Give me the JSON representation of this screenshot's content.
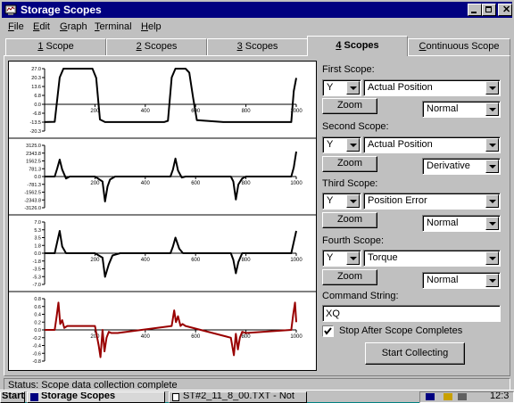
{
  "window": {
    "title": "Storage Scopes"
  },
  "menu": [
    {
      "label": "File",
      "mnemonic": "F",
      "rest": "ile"
    },
    {
      "label": "Edit",
      "mnemonic": "E",
      "rest": "dit"
    },
    {
      "label": "Graph",
      "mnemonic": "G",
      "rest": "raph"
    },
    {
      "label": "Terminal",
      "mnemonic": "T",
      "rest": "erminal"
    },
    {
      "label": "Help",
      "mnemonic": "H",
      "rest": "elp"
    }
  ],
  "tabs": [
    {
      "label": "1 Scope",
      "mnemonic": "1",
      "rest": " Scope"
    },
    {
      "label": "2 Scopes",
      "mnemonic": "2",
      "rest": " Scopes"
    },
    {
      "label": "3 Scopes",
      "mnemonic": "3",
      "rest": " Scopes"
    },
    {
      "label": "4 Scopes",
      "mnemonic": "4",
      "rest": " Scopes",
      "active": true
    },
    {
      "label": "Continuous Scope",
      "mnemonic": "C",
      "rest": "ontinuous Scope"
    }
  ],
  "scopes": [
    {
      "heading": "First Scope:",
      "axis": "Y",
      "source": "Actual Position",
      "zoom_label": "Zoom",
      "mode": "Normal"
    },
    {
      "heading": "Second Scope:",
      "axis": "Y",
      "source": "Actual Position",
      "zoom_label": "Zoom",
      "mode": "Derivative"
    },
    {
      "heading": "Third Scope:",
      "axis": "Y",
      "source": "Position Error",
      "zoom_label": "Zoom",
      "mode": "Normal"
    },
    {
      "heading": "Fourth Scope:",
      "axis": "Y",
      "source": "Torque",
      "zoom_label": "Zoom",
      "mode": "Normal"
    }
  ],
  "command": {
    "label": "Command String:",
    "value": "XQ"
  },
  "stop_after": {
    "label": "Stop After Scope Completes",
    "checked": true
  },
  "start_button": "Start Collecting",
  "status_text": "Status: Scope data collection complete",
  "taskbar": {
    "start_label": "Start",
    "items": [
      "Storage Scopes",
      "ST#2_11_8_00.TXT - Not"
    ],
    "clock": "12:3"
  },
  "colors": {
    "trace_black": "#000000",
    "trace_red": "#990000",
    "titlebar": "#000080",
    "face": "#c0c0c0",
    "desktop": "#008080"
  },
  "chart_data": [
    {
      "type": "line",
      "yticks": [
        "27.0",
        "20.3",
        "13.6",
        "6.8",
        "0.0",
        "-6.8",
        "-13.5",
        "-20.3"
      ],
      "xticks": [
        "200",
        "400",
        "600",
        "800",
        "1000"
      ],
      "xlim": [
        0,
        1000
      ],
      "ylim": [
        -20.3,
        27.0
      ],
      "color": "#000000",
      "x": [
        0,
        40,
        60,
        75,
        190,
        205,
        220,
        240,
        475,
        490,
        505,
        520,
        560,
        575,
        590,
        605,
        710,
        725,
        740,
        755,
        980,
        990,
        1000
      ],
      "y": [
        -13.5,
        -13.3,
        20.3,
        27.0,
        27.0,
        20.0,
        -11.5,
        -13.5,
        -13.5,
        -12.5,
        20.3,
        27.0,
        27.0,
        24.0,
        5.0,
        -12.0,
        -13.5,
        -13.5,
        -13.5,
        -13.5,
        -13.5,
        10.0,
        20.0
      ]
    },
    {
      "type": "line",
      "yticks": [
        "3125.0",
        "2343.8",
        "1562.5",
        "781.3",
        "0.0",
        "-781.3",
        "-1562.5",
        "-2343.8",
        "-3126.0"
      ],
      "xticks": [
        "200",
        "400",
        "600",
        "800",
        "1000"
      ],
      "xlim": [
        0,
        1000
      ],
      "ylim": [
        -3126.0,
        3125.0
      ],
      "color": "#000000",
      "x": [
        0,
        40,
        50,
        60,
        70,
        85,
        100,
        200,
        230,
        240,
        250,
        260,
        280,
        300,
        500,
        510,
        520,
        530,
        545,
        560,
        740,
        750,
        760,
        770,
        785,
        800,
        980,
        990,
        1000
      ],
      "y": [
        0,
        0,
        800,
        1700,
        700,
        -200,
        0,
        0,
        -500,
        -2500,
        -1000,
        -300,
        0,
        0,
        0,
        700,
        1800,
        600,
        -100,
        0,
        0,
        -500,
        -2300,
        -800,
        -200,
        0,
        0,
        900,
        2500
      ]
    },
    {
      "type": "line",
      "yticks": [
        "7.0",
        "5.3",
        "3.5",
        "1.8",
        "0.0",
        "-1.8",
        "-3.5",
        "-5.3",
        "-7.0"
      ],
      "xticks": [
        "200",
        "400",
        "600",
        "800",
        "1000"
      ],
      "xlim": [
        0,
        1000
      ],
      "ylim": [
        -7.0,
        7.0
      ],
      "color": "#000000",
      "x": [
        0,
        40,
        50,
        60,
        70,
        85,
        200,
        230,
        240,
        255,
        270,
        300,
        500,
        510,
        520,
        535,
        550,
        740,
        750,
        760,
        770,
        785,
        980,
        990,
        1000
      ],
      "y": [
        0,
        0,
        2.5,
        5.0,
        1.5,
        0,
        0,
        -1.0,
        -5.3,
        -2.5,
        -0.5,
        0,
        0,
        1.5,
        3.5,
        1.0,
        0,
        0,
        -1.5,
        -4.5,
        -2.0,
        0,
        0,
        2.5,
        5.0
      ]
    },
    {
      "type": "line",
      "yticks": [
        "0.8",
        "0.6",
        "0.4",
        "0.2",
        "0.0",
        "-0.2",
        "-0.4",
        "-0.6",
        "-0.8"
      ],
      "xticks": [
        "200",
        "400",
        "600",
        "800",
        "1000"
      ],
      "xlim": [
        0,
        1000
      ],
      "ylim": [
        -0.8,
        0.8
      ],
      "color": "#990000",
      "x": [
        0,
        40,
        48,
        55,
        62,
        70,
        78,
        90,
        200,
        215,
        222,
        230,
        238,
        246,
        255,
        265,
        290,
        505,
        515,
        522,
        530,
        540,
        548,
        560,
        740,
        752,
        760,
        768,
        776,
        785,
        800,
        980,
        988,
        995,
        1000
      ],
      "y": [
        0,
        0,
        0.35,
        0.7,
        0.15,
        0.25,
        0.05,
        0.1,
        0.1,
        -0.4,
        -0.7,
        0.0,
        -0.55,
        -0.2,
        -0.05,
        -0.08,
        -0.08,
        0.1,
        0.5,
        0.2,
        0.35,
        0.1,
        0.15,
        0.1,
        -0.2,
        -0.65,
        -0.1,
        -0.5,
        -0.2,
        -0.05,
        -0.08,
        0.0,
        0.4,
        0.7,
        0.2
      ]
    }
  ]
}
